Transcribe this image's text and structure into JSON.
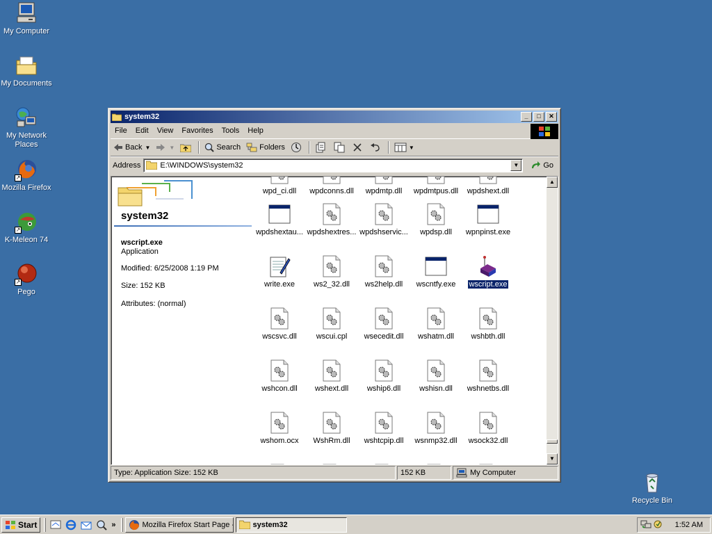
{
  "desktop": {
    "icons": [
      {
        "label": "My Computer"
      },
      {
        "label": "My Documents"
      },
      {
        "label": "My Network Places"
      },
      {
        "label": "Mozilla Firefox"
      },
      {
        "label": "K-Meleon 74"
      },
      {
        "label": "Pego"
      },
      {
        "label": "Recycle Bin"
      }
    ]
  },
  "window": {
    "title": "system32",
    "menu": [
      "File",
      "Edit",
      "View",
      "Favorites",
      "Tools",
      "Help"
    ],
    "toolbar": {
      "back": "Back",
      "search": "Search",
      "folders": "Folders"
    },
    "address": {
      "label": "Address",
      "value": "E:\\WINDOWS\\system32",
      "go": "Go"
    },
    "details": {
      "folder_title": "system32",
      "selected_name": "wscript.exe",
      "selected_type": "Application",
      "modified": "Modified: 6/25/2008 1:19 PM",
      "size": "Size: 152 KB",
      "attributes": "Attributes: (normal)"
    },
    "files": [
      {
        "name": "wpd_ci.dll",
        "icon": "dll-icon"
      },
      {
        "name": "wpdconns.dll",
        "icon": "dll-icon"
      },
      {
        "name": "wpdmtp.dll",
        "icon": "dll-icon"
      },
      {
        "name": "wpdmtpus.dll",
        "icon": "dll-icon"
      },
      {
        "name": "wpdshext.dll",
        "icon": "dll-icon"
      },
      {
        "name": "wpdshextau...",
        "icon": "exe-window-icon"
      },
      {
        "name": "wpdshextres...",
        "icon": "dll-icon"
      },
      {
        "name": "wpdshservic...",
        "icon": "dll-icon"
      },
      {
        "name": "wpdsp.dll",
        "icon": "dll-icon"
      },
      {
        "name": "wpnpinst.exe",
        "icon": "exe-window-icon"
      },
      {
        "name": "write.exe",
        "icon": "notepad-icon"
      },
      {
        "name": "ws2_32.dll",
        "icon": "dll-icon"
      },
      {
        "name": "ws2help.dll",
        "icon": "dll-icon"
      },
      {
        "name": "wscntfy.exe",
        "icon": "exe-window-icon"
      },
      {
        "name": "wscript.exe",
        "icon": "script-host-icon",
        "selected": true
      },
      {
        "name": "wscsvc.dll",
        "icon": "dll-icon"
      },
      {
        "name": "wscui.cpl",
        "icon": "dll-icon"
      },
      {
        "name": "wsecedit.dll",
        "icon": "dll-icon"
      },
      {
        "name": "wshatm.dll",
        "icon": "dll-icon"
      },
      {
        "name": "wshbth.dll",
        "icon": "dll-icon"
      },
      {
        "name": "wshcon.dll",
        "icon": "dll-icon"
      },
      {
        "name": "wshext.dll",
        "icon": "dll-icon"
      },
      {
        "name": "wship6.dll",
        "icon": "dll-icon"
      },
      {
        "name": "wshisn.dll",
        "icon": "dll-icon"
      },
      {
        "name": "wshnetbs.dll",
        "icon": "dll-icon"
      },
      {
        "name": "wshom.ocx",
        "icon": "dll-icon"
      },
      {
        "name": "WshRm.dll",
        "icon": "dll-icon"
      },
      {
        "name": "wshtcpip.dll",
        "icon": "dll-icon"
      },
      {
        "name": "wsnmp32.dll",
        "icon": "dll-icon"
      },
      {
        "name": "wsock32.dll",
        "icon": "dll-icon"
      }
    ],
    "status": {
      "info": "Type: Application Size: 152 KB",
      "size": "152 KB",
      "zone": "My Computer"
    }
  },
  "taskbar": {
    "start": "Start",
    "tasks": [
      {
        "label": "Mozilla Firefox Start Page -..."
      },
      {
        "label": "system32",
        "active": true
      }
    ],
    "clock": "1:52 AM"
  },
  "colors": {
    "desktop": "#3a6ea5",
    "titlebar_start": "#0a246a",
    "titlebar_end": "#a6caf0",
    "selection": "#0a246a",
    "face": "#d4d0c8"
  }
}
